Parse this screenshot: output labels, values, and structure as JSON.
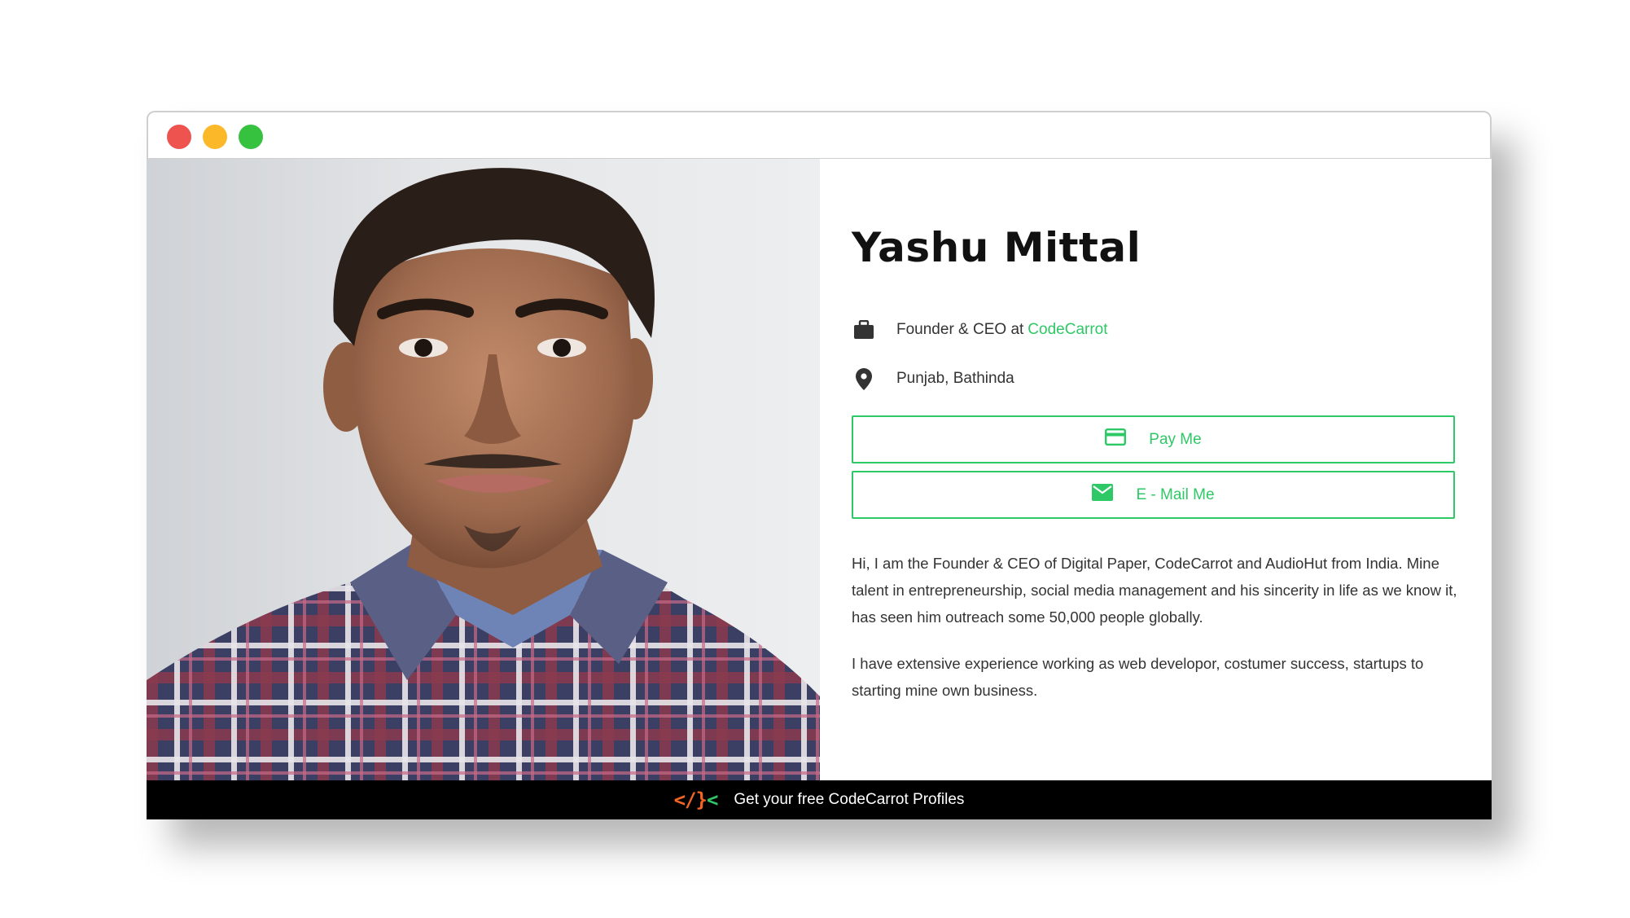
{
  "profile": {
    "name": "Yashu Mittal",
    "role": "Founder & CEO at",
    "company": "CodeCarrot",
    "location": "Punjab, Bathinda",
    "photo_alt": "Profile photo"
  },
  "actions": {
    "pay_label": "Pay Me",
    "mail_label": "E - Mail Me"
  },
  "bio": {
    "paragraph_1": "Hi, I am the Founder & CEO of Digital Paper, CodeCarrot and AudioHut from India. Mine talent in entrepreneurship, social media management and his sincerity in life as we know it, has seen him outreach some 50,000 people globally.",
    "paragraph_2": "I have extensive experience working as web developor, costumer success, startups to starting mine own business."
  },
  "footer": {
    "logo_left": "</",
    "logo_mid": "}",
    "logo_right": "<",
    "text": "Get your free CodeCarrot Profiles"
  },
  "icons": {
    "job": "briefcase-icon",
    "location": "map-pin-icon",
    "pay": "credit-card-icon",
    "mail": "envelope-icon"
  },
  "colors": {
    "accent": "#2ec866",
    "footer_bg": "#000000",
    "dot_red": "#ef5350",
    "dot_yellow": "#fbb829",
    "dot_green": "#36c13e",
    "logo_orange": "#f26522",
    "logo_green": "#2ec866"
  }
}
